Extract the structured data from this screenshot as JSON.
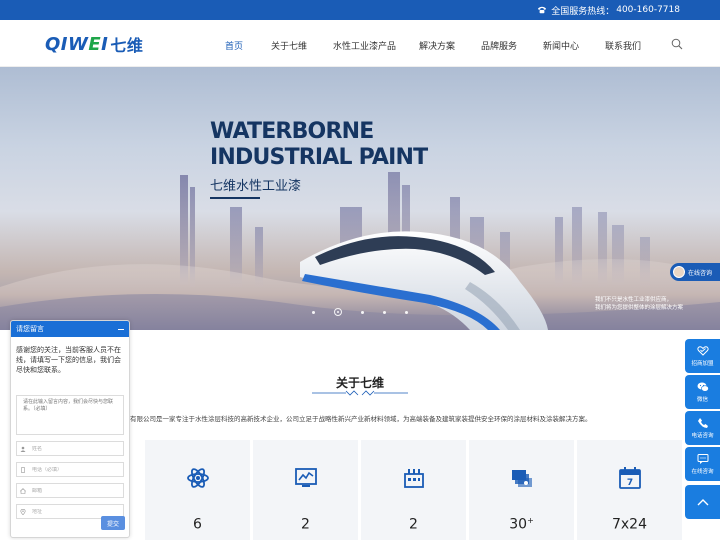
{
  "topbar": {
    "hotline_label": "全国服务热线：",
    "hotline_number": "400-160-7718"
  },
  "header": {
    "logo": {
      "latin_start": "QIW",
      "latin_e": "E",
      "latin_end": "I",
      "cn": "七维"
    },
    "nav": [
      "首页",
      "关于七维",
      "水性工业漆产品",
      "解决方案",
      "品牌服务",
      "新闻中心",
      "联系我们"
    ],
    "active_nav_index": 0
  },
  "hero": {
    "title": "WATERBORNE\nINDUSTRIAL PAINT",
    "subtitle": "七维水性工业漆",
    "caption": "我们不只是水性工业漆供应商，\n我们将为您提供整体的涂层解决方案",
    "slides": 5,
    "active_slide": 1
  },
  "online_chat_float": {
    "label": "在线咨询"
  },
  "about": {
    "title": "关于七维",
    "intro": "有限公司是一家专注于水性涂层科技的高新技术企业，公司立足于战略性新兴产业新材料领域，为高端装备及建筑家装提供安全环保的涂层材料及涂装解决方案。",
    "stats": [
      {
        "icon": "atom-icon",
        "value": "6",
        "sup": ""
      },
      {
        "icon": "chart-monitor-icon",
        "value": "2",
        "sup": ""
      },
      {
        "icon": "factory-icon",
        "value": "2",
        "sup": ""
      },
      {
        "icon": "certificate-stack-icon",
        "value": "30",
        "sup": "+"
      },
      {
        "icon": "calendar-7-icon",
        "value": "7x24",
        "sup": ""
      }
    ]
  },
  "side_toolbar": {
    "items": [
      {
        "icon": "handshake-heart-icon",
        "label": "招商加盟"
      },
      {
        "icon": "wechat-icon",
        "label": "微信"
      },
      {
        "icon": "phone-icon",
        "label": "电话咨询"
      },
      {
        "icon": "chat-bubble-icon",
        "label": "在线咨询"
      }
    ]
  },
  "message_panel": {
    "title": "请您留言",
    "notice": "感谢您的关注，当前客服人员不在线，请填写一下您的信息，我们会尽快和您联系。",
    "textarea_placeholder": "请在此输入留言内容，我们会尽快与您联系。（必填）",
    "fields": [
      {
        "icon": "user-icon",
        "placeholder": "姓名"
      },
      {
        "icon": "phone-icon",
        "placeholder": "电话（必填）"
      },
      {
        "icon": "house-icon",
        "placeholder": "邮箱"
      },
      {
        "icon": "location-icon",
        "placeholder": "地址"
      }
    ],
    "submit_label": "提交"
  }
}
